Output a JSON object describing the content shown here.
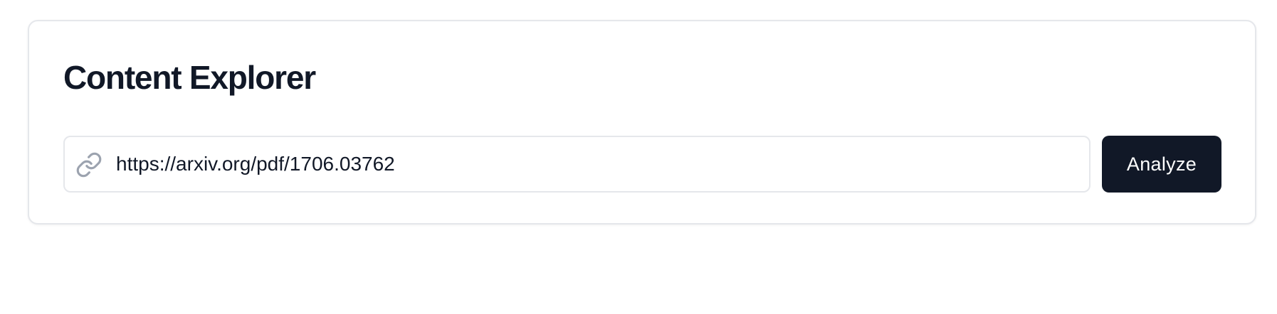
{
  "page": {
    "title": "Content Explorer"
  },
  "url_field": {
    "value": "https://arxiv.org/pdf/1706.03762",
    "icon": "link-icon"
  },
  "actions": {
    "analyze_label": "Analyze"
  },
  "colors": {
    "title_text": "#111827",
    "button_background": "#111827",
    "button_text": "#ffffff",
    "border": "#e5e7eb",
    "icon": "#9ca3af"
  }
}
